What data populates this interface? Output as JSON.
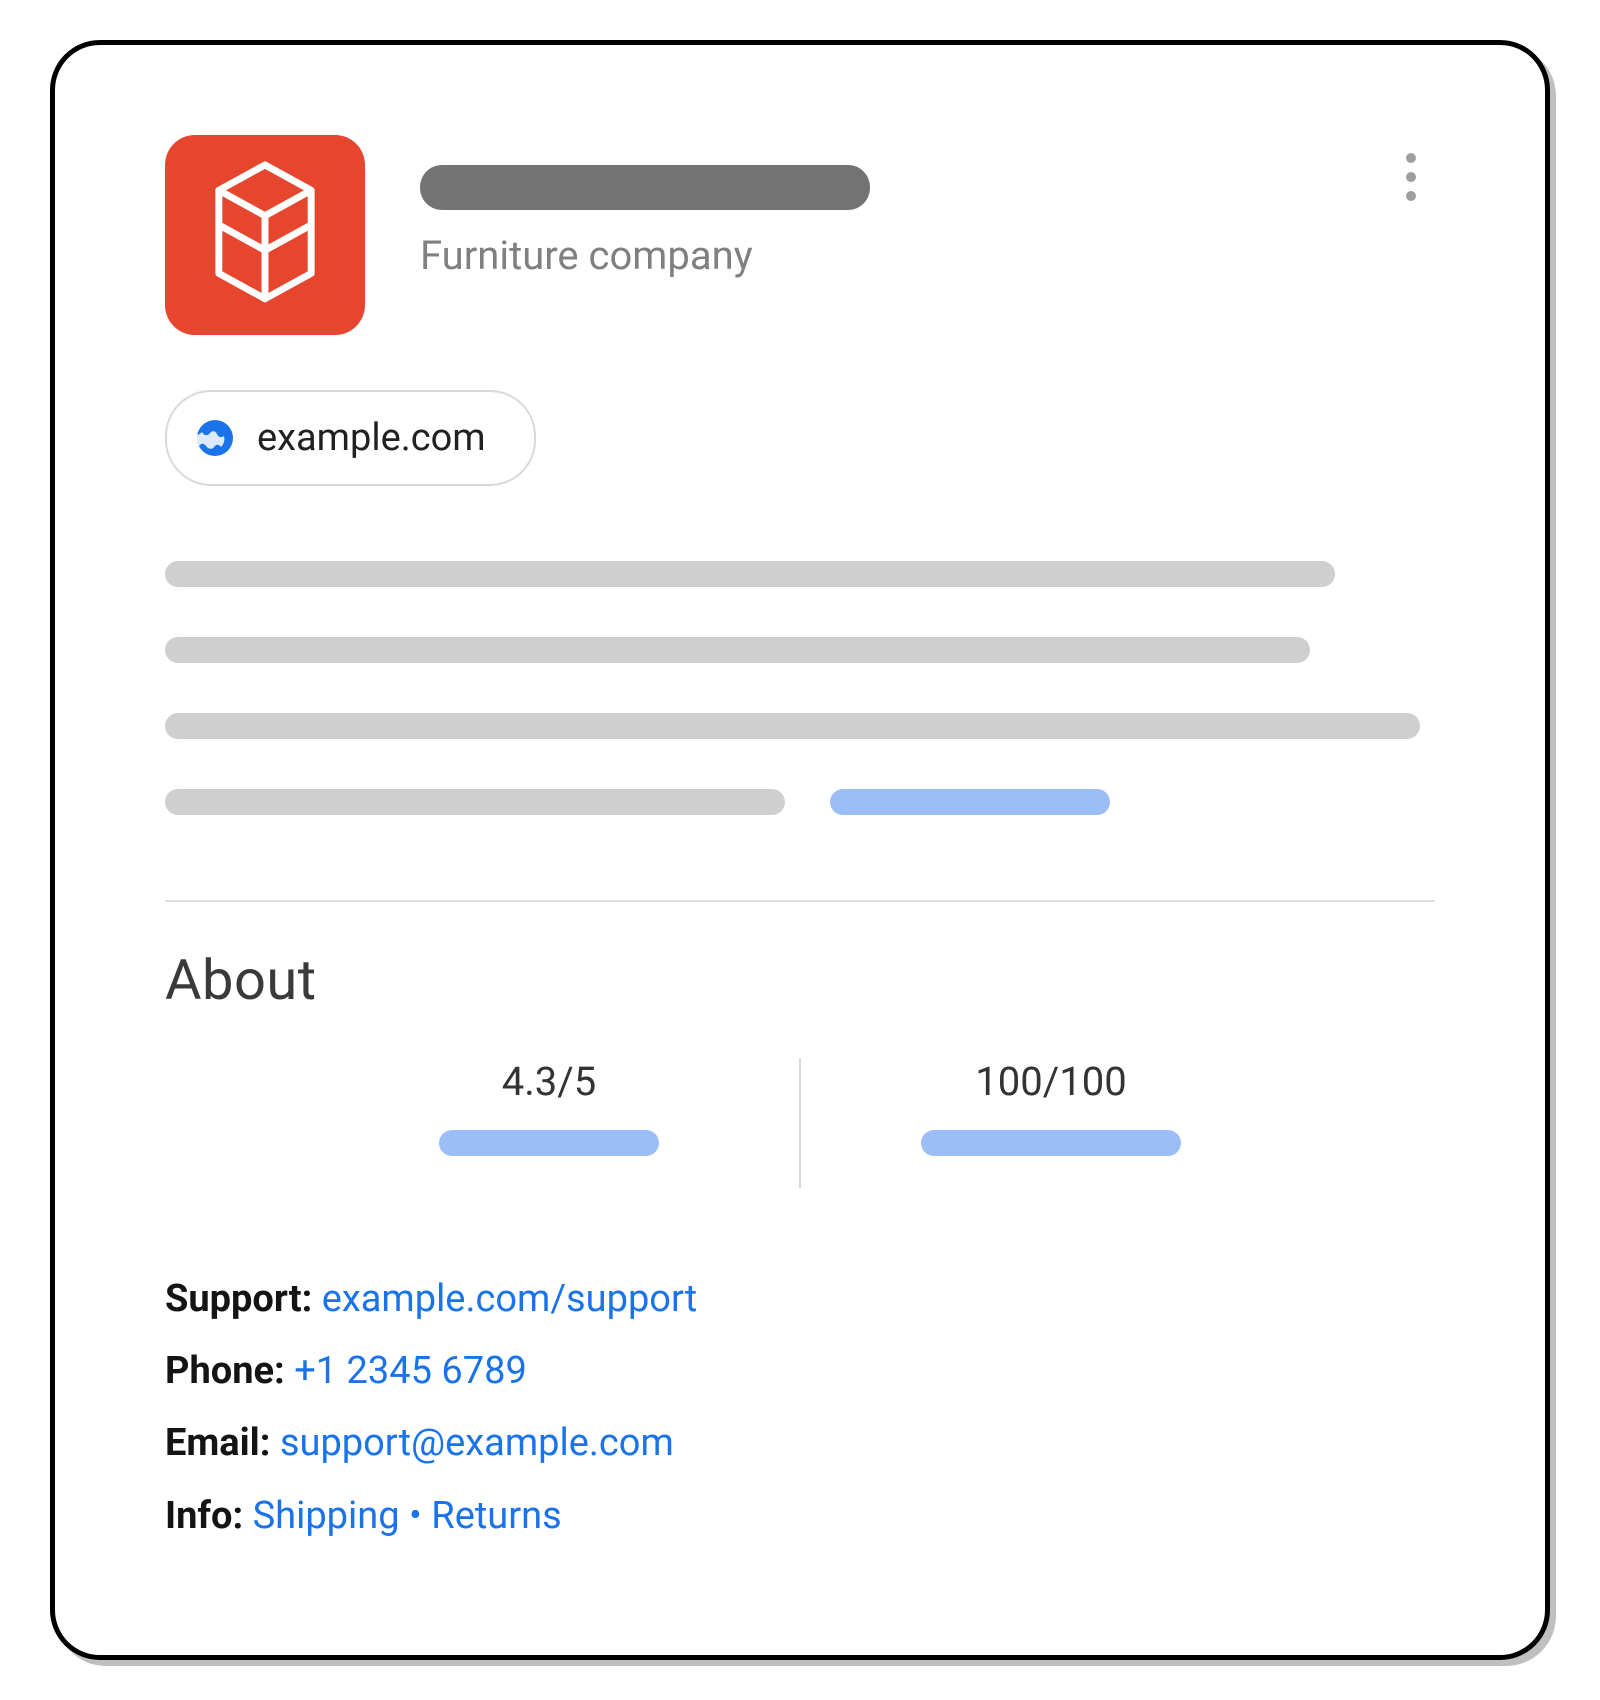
{
  "header": {
    "subtitle": "Furniture company",
    "site": "example.com"
  },
  "about": {
    "title": "About",
    "rating": "4.3/5",
    "score": "100/100"
  },
  "contact": {
    "support_label": "Support:",
    "support_link": "example.com/support",
    "phone_label": "Phone:",
    "phone_link": "+1 2345 6789",
    "email_label": "Email:",
    "email_link": "support@example.com",
    "info_label": "Info:",
    "info_shipping": "Shipping",
    "info_separator": "•",
    "info_returns": "Returns"
  }
}
